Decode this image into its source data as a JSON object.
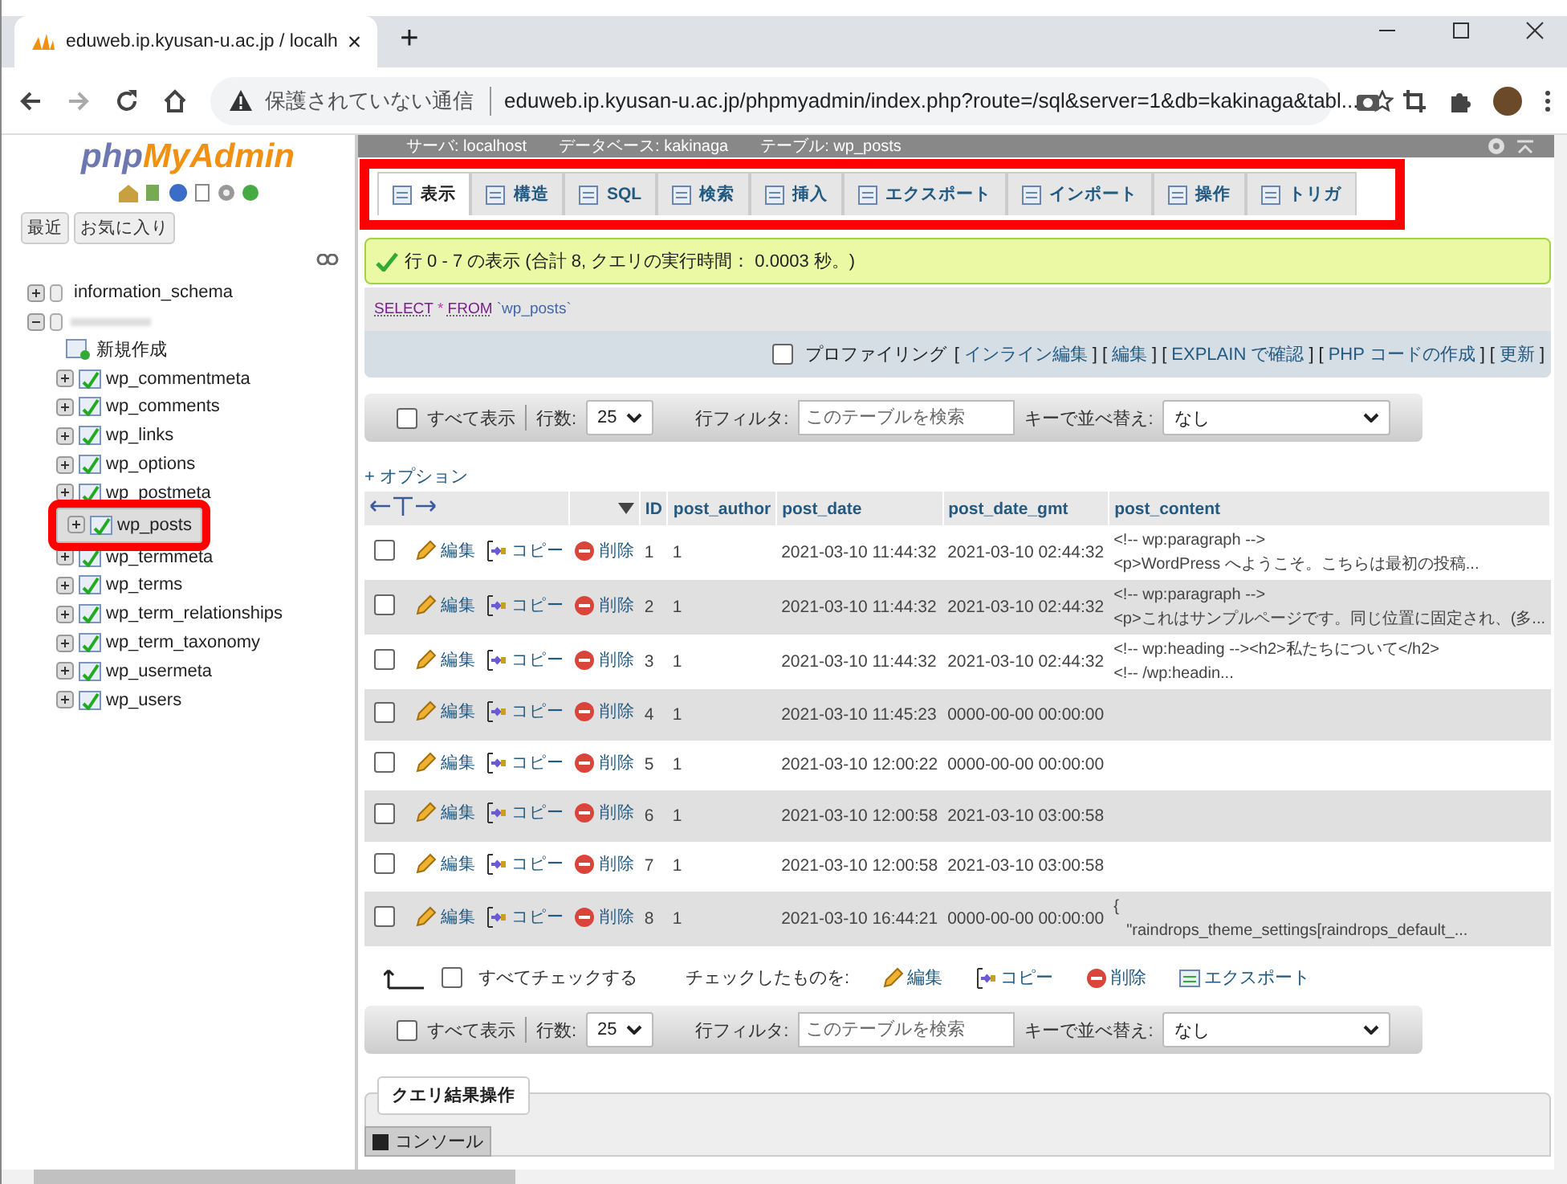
{
  "browser": {
    "tab_title": "eduweb.ip.kyusan-u.ac.jp / localh",
    "tab_close": "×",
    "new_tab": "+",
    "security": "保護されていない通信",
    "url": "eduweb.ip.kyusan-u.ac.jp/phpmyadmin/index.php?route=/sql&server=1&db=kakinaga&tabl..."
  },
  "sidebar": {
    "logo_php": "php",
    "logo_my": "MyAdmin",
    "buttons": [
      "最近",
      "お気に入り"
    ],
    "tree": [
      {
        "label": "information_schema",
        "expanded": false
      },
      {
        "expanded": true,
        "children": [
          {
            "label": "新規作成",
            "kind": "new",
            "selected": false,
            "highlighted": false
          },
          {
            "label": "wp_commentmeta",
            "kind": "table",
            "selected": false,
            "highlighted": false
          },
          {
            "label": "wp_comments",
            "kind": "table",
            "selected": false,
            "highlighted": false
          },
          {
            "label": "wp_links",
            "kind": "table",
            "selected": false,
            "highlighted": false
          },
          {
            "label": "wp_options",
            "kind": "table",
            "selected": false,
            "highlighted": false
          },
          {
            "label": "wp_postmeta",
            "kind": "table",
            "selected": false,
            "highlighted": false
          },
          {
            "label": "wp_posts",
            "kind": "table",
            "selected": true,
            "highlighted": true
          },
          {
            "label": "wp_termmeta",
            "kind": "table",
            "selected": false,
            "highlighted": false
          },
          {
            "label": "wp_terms",
            "kind": "table",
            "selected": false,
            "highlighted": false
          },
          {
            "label": "wp_term_relationships",
            "kind": "table",
            "selected": false,
            "highlighted": false
          },
          {
            "label": "wp_term_taxonomy",
            "kind": "table",
            "selected": false,
            "highlighted": false
          },
          {
            "label": "wp_usermeta",
            "kind": "table",
            "selected": false,
            "highlighted": false
          },
          {
            "label": "wp_users",
            "kind": "table",
            "selected": false,
            "highlighted": false
          }
        ]
      }
    ]
  },
  "breadcrumb": [
    "サーバ: localhost",
    "データベース: kakinaga",
    "テーブル: wp_posts"
  ],
  "tabs_highlighted": true,
  "tabs": [
    {
      "label": "表示",
      "selected": true
    },
    {
      "label": "構造",
      "selected": false
    },
    {
      "label": "SQL",
      "selected": false
    },
    {
      "label": "検索",
      "selected": false
    },
    {
      "label": "挿入",
      "selected": false
    },
    {
      "label": "エクスポート",
      "selected": false
    },
    {
      "label": "インポート",
      "selected": false
    },
    {
      "label": "操作",
      "selected": false
    },
    {
      "label": "トリガ",
      "selected": false
    }
  ],
  "success": "行 0 - 7 の表示 (合計 8, クエリの実行時間： 0.0003 秒。)",
  "sql": {
    "select": "SELECT",
    "star": "*",
    "from": "FROM",
    "table": "`wp_posts`"
  },
  "profiling": {
    "label": "プロファイリング",
    "checked": false,
    "links": [
      {
        "open": "[",
        "label": "インライン編集",
        "close": "]"
      },
      {
        "open": "[",
        "label": "編集",
        "close": "]"
      },
      {
        "open": "[",
        "label": "EXPLAIN で確認",
        "close": "]"
      },
      {
        "open": "[",
        "label": "PHP コードの作成",
        "close": "]"
      },
      {
        "open": "[",
        "label": "更新",
        "close": "]"
      }
    ]
  },
  "nav_top": {
    "show_all": "すべて表示",
    "show_all_checked": false,
    "rows_label": "行数:",
    "rows": "25",
    "filter_label": "行フィルタ:",
    "filter_placeholder": "このテーブルを検索",
    "sort_label": "キーで並べ替え:",
    "sort": "なし"
  },
  "options": "+ オプション",
  "table": {
    "columns": [
      "ID",
      "post_author",
      "post_date",
      "post_date_gmt",
      "post_content"
    ],
    "rows": [
      {
        "checked": false,
        "actions": [
          "編集",
          "コピー",
          "削除"
        ],
        "id": "1",
        "author": "1",
        "date": "2021-03-10 11:44:32",
        "gmt": "2021-03-10 02:44:32",
        "content": [
          "<!-- wp:paragraph -->",
          "<p>WordPress へようこそ。こちらは最初の投稿..."
        ]
      },
      {
        "checked": false,
        "actions": [
          "編集",
          "コピー",
          "削除"
        ],
        "id": "2",
        "author": "1",
        "date": "2021-03-10 11:44:32",
        "gmt": "2021-03-10 02:44:32",
        "content": [
          "<!-- wp:paragraph -->",
          "<p>これはサンプルページです。同じ位置に固定され、(多..."
        ]
      },
      {
        "checked": false,
        "actions": [
          "編集",
          "コピー",
          "削除"
        ],
        "id": "3",
        "author": "1",
        "date": "2021-03-10 11:44:32",
        "gmt": "2021-03-10 02:44:32",
        "content": [
          "<!-- wp:heading --><h2>私たちについて</h2>",
          "<!-- /wp:headin..."
        ]
      },
      {
        "checked": false,
        "actions": [
          "編集",
          "コピー",
          "削除"
        ],
        "id": "4",
        "author": "1",
        "date": "2021-03-10 11:45:23",
        "gmt": "0000-00-00 00:00:00"
      },
      {
        "checked": false,
        "actions": [
          "編集",
          "コピー",
          "削除"
        ],
        "id": "5",
        "author": "1",
        "date": "2021-03-10 12:00:22",
        "gmt": "0000-00-00 00:00:00"
      },
      {
        "checked": false,
        "actions": [
          "編集",
          "コピー",
          "削除"
        ],
        "id": "6",
        "author": "1",
        "date": "2021-03-10 12:00:58",
        "gmt": "2021-03-10 03:00:58"
      },
      {
        "checked": false,
        "actions": [
          "編集",
          "コピー",
          "削除"
        ],
        "id": "7",
        "author": "1",
        "date": "2021-03-10 12:00:58",
        "gmt": "2021-03-10 03:00:58"
      },
      {
        "checked": false,
        "actions": [
          "編集",
          "コピー",
          "削除"
        ],
        "id": "8",
        "author": "1",
        "date": "2021-03-10 16:44:21",
        "gmt": "0000-00-00 00:00:00",
        "content": [
          "{",
          "\"raindrops_theme_settings[raindrops_default_..."
        ]
      }
    ]
  },
  "bulk": {
    "check_all": "すべてチェックする",
    "checked": false,
    "with_selected": "チェックしたものを:",
    "actions": [
      "編集",
      "コピー",
      "削除",
      "エクスポート"
    ]
  },
  "nav_bottom": {
    "show_all": "すべて表示",
    "show_all_checked": false,
    "rows_label": "行数:",
    "rows": "25",
    "filter_label": "行フィルタ:",
    "filter_placeholder": "このテーブルを検索",
    "sort_label": "キーで並べ替え:",
    "sort": "なし"
  },
  "query_ops": "クエリ結果操作",
  "console": "コンソール"
}
